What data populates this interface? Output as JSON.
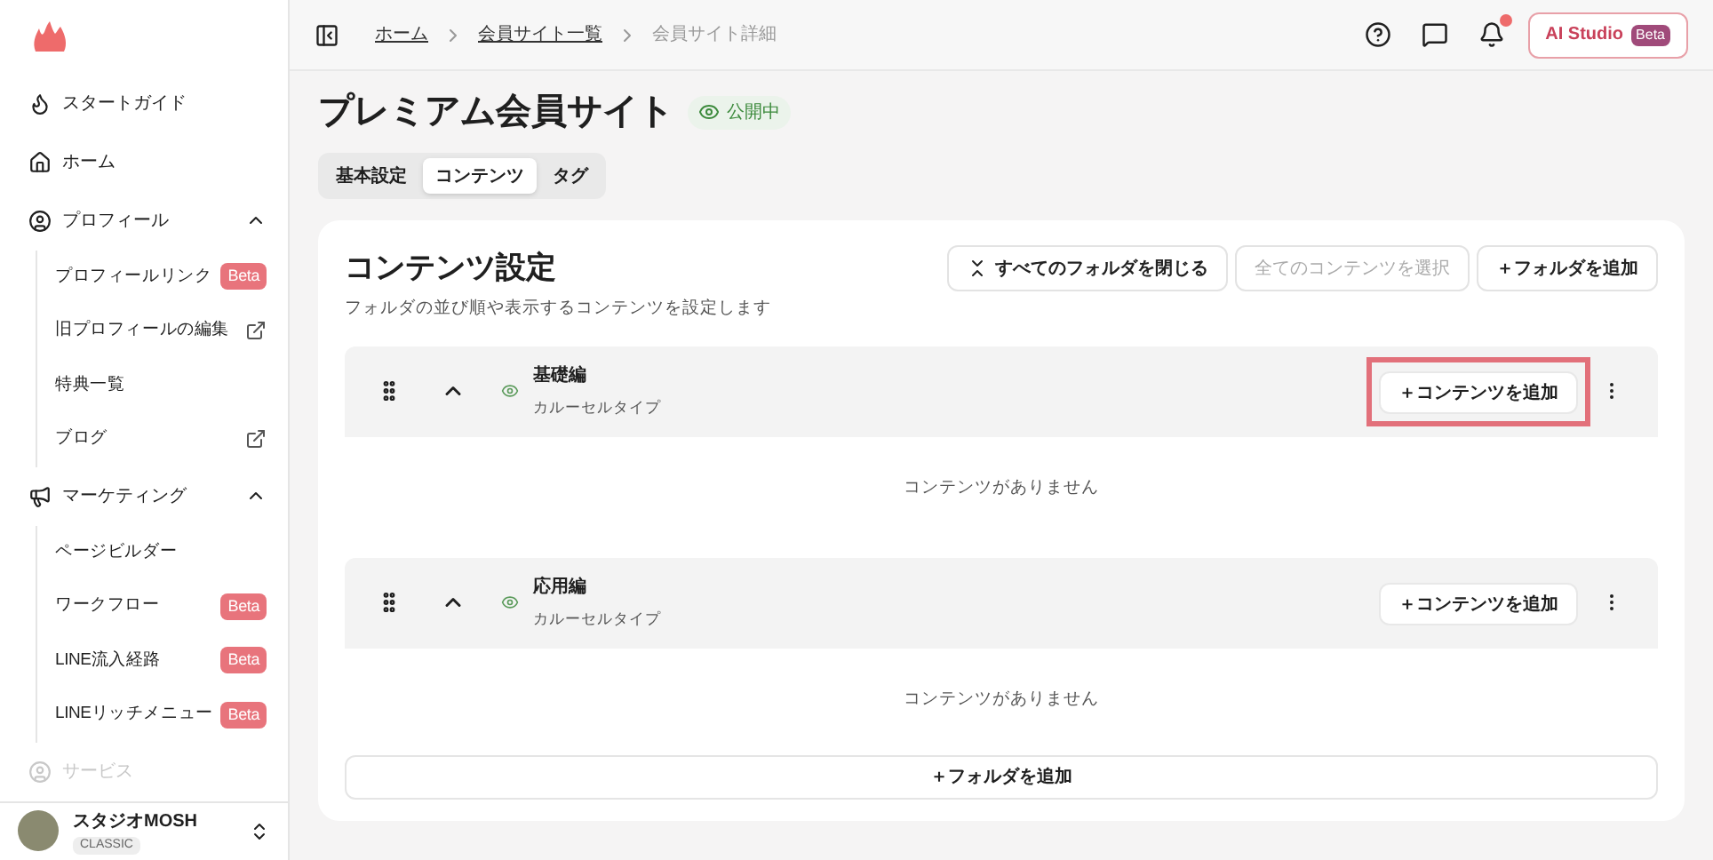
{
  "sidebar": {
    "items": [
      {
        "label": "スタートガイド",
        "kind": "link"
      },
      {
        "label": "ホーム",
        "kind": "link"
      },
      {
        "label": "プロフィール",
        "kind": "group",
        "expanded": true,
        "children": [
          {
            "label": "プロフィールリンク",
            "badge": "Beta"
          },
          {
            "label": "旧プロフィールの編集",
            "external": true
          },
          {
            "label": "特典一覧"
          },
          {
            "label": "ブログ",
            "external": true
          }
        ]
      },
      {
        "label": "マーケティング",
        "kind": "group",
        "expanded": true,
        "children": [
          {
            "label": "ページビルダー"
          },
          {
            "label": "ワークフロー",
            "badge": "Beta"
          },
          {
            "label": "LINE流入経路",
            "badge": "Beta"
          },
          {
            "label": "LINEリッチメニュー",
            "badge": "Beta"
          }
        ]
      },
      {
        "label": "サービス",
        "kind": "faded"
      }
    ],
    "account": {
      "name": "スタジオMOSH",
      "plan": "CLASSIC"
    }
  },
  "breadcrumb": [
    {
      "label": "ホーム",
      "link": true
    },
    {
      "label": "会員サイト一覧",
      "link": true
    },
    {
      "label": "会員サイト詳細",
      "link": false
    }
  ],
  "header": {
    "notification_dot": true,
    "ai_button": "AI Studio",
    "ai_badge": "Beta"
  },
  "page": {
    "title": "プレミアム会員サイト",
    "status": "公開中"
  },
  "tabs": [
    {
      "label": "基本設定",
      "selected": false
    },
    {
      "label": "コンテンツ",
      "selected": true
    },
    {
      "label": "タグ",
      "selected": false
    }
  ],
  "card": {
    "title": "コンテンツ設定",
    "subtitle": "フォルダの並び順や表示するコンテンツを設定します",
    "actions": [
      {
        "label": "すべてのフォルダを閉じる",
        "disabled": false,
        "kind": "collapse"
      },
      {
        "label": "全てのコンテンツを選択",
        "disabled": true
      },
      {
        "label": "＋フォルダを追加",
        "disabled": false
      }
    ],
    "folders": [
      {
        "name": "基礎編",
        "type": "カルーセルタイプ",
        "expanded": true,
        "add_button": "＋コンテンツを追加",
        "highlighted": true,
        "empty": "コンテンツがありません"
      },
      {
        "name": "応用編",
        "type": "カルーセルタイプ",
        "expanded": true,
        "add_button": "＋コンテンツを追加",
        "highlighted": false,
        "empty": "コンテンツがありません"
      }
    ],
    "add_folder": "＋フォルダを追加"
  }
}
